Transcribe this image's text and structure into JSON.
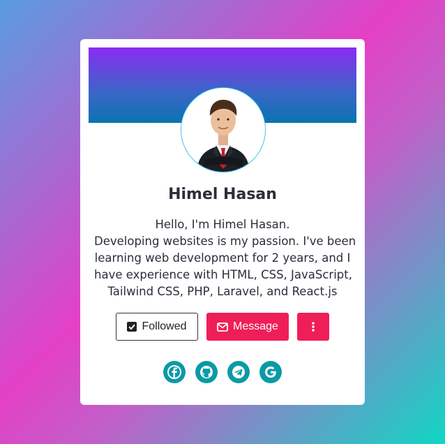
{
  "profile": {
    "name": "Himel Hasan",
    "bio_lines": [
      "Hello, I'm Himel Hasan.",
      "Developing websites is my passion. I've been",
      "learning web development for 2 years, and I",
      "have experience with HTML, CSS, JavaScript,",
      "Tailwind CSS, PHP, Laravel, and React.js"
    ]
  },
  "actions": {
    "followed_label": "Followed",
    "message_label": "Message",
    "more_icon": "vertical-ellipsis-icon"
  },
  "socials": [
    {
      "icon": "facebook-icon"
    },
    {
      "icon": "github-icon"
    },
    {
      "icon": "telegram-icon"
    },
    {
      "icon": "google-icon"
    }
  ],
  "colors": {
    "accent": "#f01e58",
    "social": "#0a9aa6",
    "banner_top": "#8a2cf0",
    "banner_bottom": "#0b73b0"
  }
}
